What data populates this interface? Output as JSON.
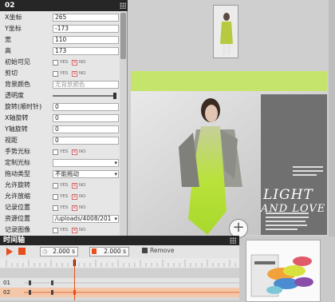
{
  "props_panel": {
    "title": "02",
    "rows": [
      {
        "label": "X坐标",
        "type": "text",
        "value": "265"
      },
      {
        "label": "Y坐标",
        "type": "text",
        "value": "-173"
      },
      {
        "label": "宽",
        "type": "text",
        "value": "110"
      },
      {
        "label": "高",
        "type": "text",
        "value": "173"
      },
      {
        "label": "初始可见",
        "type": "yesno",
        "selected": "no"
      },
      {
        "label": "剪切",
        "type": "yesno",
        "selected": "no"
      },
      {
        "label": "背景颜色",
        "type": "text",
        "placeholder": "无背景颜色"
      },
      {
        "label": "透明度",
        "type": "slider",
        "value": 1.0
      },
      {
        "label": "旋转(顺时针)",
        "type": "text",
        "value": "0"
      },
      {
        "label": "X轴旋转",
        "type": "text",
        "value": "0"
      },
      {
        "label": "Y轴旋转",
        "type": "text",
        "value": "0"
      },
      {
        "label": "视距",
        "type": "text",
        "value": "0"
      },
      {
        "label": "手势光标",
        "type": "yesno",
        "selected": "no"
      },
      {
        "label": "定制光标",
        "type": "select",
        "value": ""
      },
      {
        "label": "拖动类型",
        "type": "select",
        "value": "不能拖动"
      },
      {
        "label": "允许旋转",
        "type": "yesno",
        "selected": "no"
      },
      {
        "label": "允许放缩",
        "type": "yesno",
        "selected": "no"
      },
      {
        "label": "记录位置",
        "type": "yesno",
        "selected": "no"
      },
      {
        "label": "资源位置",
        "type": "select",
        "value": "/uploads/4008/201"
      },
      {
        "label": "记录图像",
        "type": "yesno",
        "selected": "no"
      }
    ],
    "yes_label": "YES",
    "no_label": "NO"
  },
  "timeline": {
    "title": "时间轴",
    "time_a": "2.000 s",
    "time_b": "2.000 s",
    "remove_label": "Remove",
    "tracks": [
      "01",
      "02"
    ]
  },
  "canvas": {
    "headline": "LIGHT",
    "subheadline": "AND LOVE",
    "accent": "#c5e46b",
    "brand_red": "#e84e1b"
  }
}
